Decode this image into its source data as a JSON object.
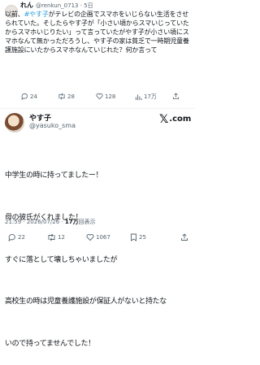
{
  "quoted_tweet": {
    "display_name": "れん",
    "handle_time": "@renkun_0713 · 5日",
    "body_before_tag": "以前、",
    "hashtag": "#やす子",
    "body_after_tag": "がテレビの企画でスマホをいじらない生活をさせられていた。そしたらやす子が「小さい頃からスマいじっていたからスマホいじりたい」って言っていたがやす子が小さい頃にスマホなんて無かっただろうし、やす子の家は貧乏で一時期児童養護施設にいたからスマホなんていじれた？何か言って",
    "stats": {
      "replies": "24",
      "retweets": "28",
      "likes": "128",
      "views": "17万"
    }
  },
  "main_tweet": {
    "display_name": "やす子",
    "handle": "@yasuko_sma",
    "brand": "X.com",
    "brand_letter": "𝕏",
    "brand_suffix": ".com",
    "lines": [
      "中学生の時に持ってましたー！",
      "母の彼氏がくれました！",
      "すぐに落として壊しちゃいましたが",
      "高校生の時は児童養護施設が保証人がないと持たな",
      "いので持ってませんでした！"
    ],
    "time": "21:59 · 2026/07/26 · ",
    "views_count": "17万",
    "views_label": "回表示",
    "stats": {
      "replies": "22",
      "retweets": "12",
      "likes": "1067",
      "bookmarks": "25"
    }
  },
  "colors": {
    "text": "#0f1419",
    "muted": "#536471",
    "accent": "#1d9bf0",
    "divider": "#eff3f4"
  }
}
